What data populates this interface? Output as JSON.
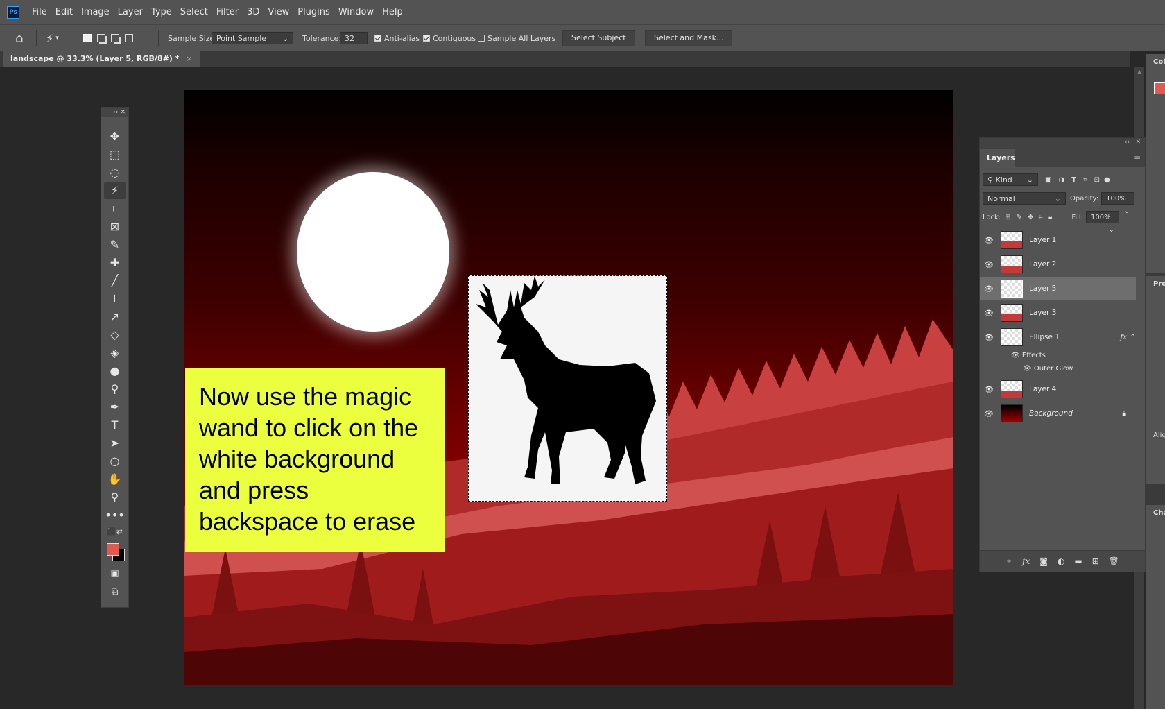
{
  "app": {
    "logo": "Ps"
  },
  "menu": [
    "File",
    "Edit",
    "Image",
    "Layer",
    "Type",
    "Select",
    "Filter",
    "3D",
    "View",
    "Plugins",
    "Window",
    "Help"
  ],
  "options": {
    "sample_size_label": "Sample Size:",
    "sample_size_value": "Point Sample",
    "tolerance_label": "Tolerance:",
    "tolerance_value": "32",
    "anti_alias": "Anti-alias",
    "contiguous": "Contiguous",
    "sample_all_layers": "Sample All Layers",
    "select_subject": "Select Subject",
    "select_and_mask": "Select and Mask..."
  },
  "document": {
    "tab_title": "landscape @ 33.3% (Layer 5, RGB/8#) *",
    "close": "×"
  },
  "note": {
    "text": "Now use the magic wand to click on the white background and press backspace to erase"
  },
  "layers_panel": {
    "title": "Layers",
    "kind_label": "Kind",
    "blend_mode": "Normal",
    "opacity_label": "Opacity:",
    "opacity_value": "100%",
    "lock_label": "Lock:",
    "fill_label": "Fill:",
    "fill_value": "100%",
    "layers": [
      {
        "name": "Layer 1"
      },
      {
        "name": "Layer 2"
      },
      {
        "name": "Layer 5",
        "selected": true
      },
      {
        "name": "Layer 3"
      },
      {
        "name": "Ellipse 1",
        "fx": "fx"
      },
      {
        "name": "Layer 4"
      },
      {
        "name": "Background"
      }
    ],
    "effects_label": "Effects",
    "outer_glow_label": "Outer Glow"
  },
  "right_dock": {
    "color_tab": "Col",
    "properties_tab": "Pro",
    "align_label": "Alig",
    "channels_tab": "Cha"
  },
  "colors": {
    "foreground": "#e05a52",
    "background": "#000000"
  }
}
